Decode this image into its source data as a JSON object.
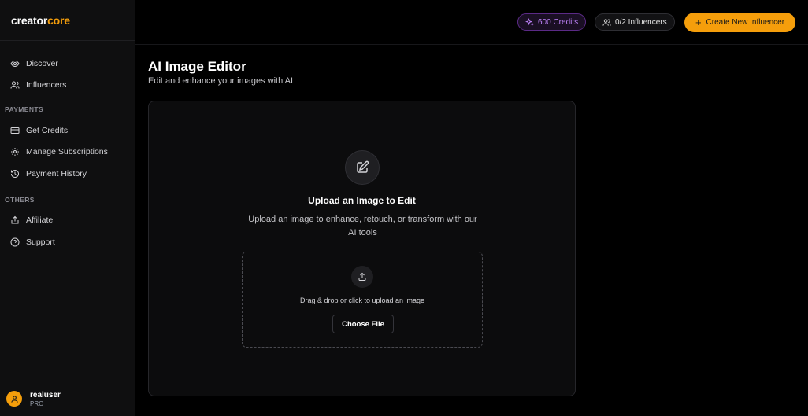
{
  "brand": {
    "part1": "creator",
    "part2": "core"
  },
  "sidebar": {
    "main_items": [
      {
        "label": "Discover",
        "icon": "eye-icon"
      },
      {
        "label": "Influencers",
        "icon": "users-icon"
      }
    ],
    "payments_label": "PAYMENTS",
    "payment_items": [
      {
        "label": "Get Credits",
        "icon": "card-icon"
      },
      {
        "label": "Manage Subscriptions",
        "icon": "gear-icon"
      },
      {
        "label": "Payment History",
        "icon": "history-icon"
      }
    ],
    "others_label": "OTHERS",
    "other_items": [
      {
        "label": "Affiliate",
        "icon": "share-icon"
      },
      {
        "label": "Support",
        "icon": "help-icon"
      }
    ]
  },
  "user": {
    "name": "realuser",
    "plan": "PRO"
  },
  "topbar": {
    "credits": "600 Credits",
    "influencers": "0/2 Influencers",
    "create_label": "Create New Influencer"
  },
  "main": {
    "title": "AI Image Editor",
    "subtitle": "Edit and enhance your images with AI",
    "card_title": "Upload an Image to Edit",
    "card_desc": "Upload an image to enhance, retouch, or transform with our AI tools",
    "dropzone_text": "Drag & drop or click to upload an image",
    "choose_label": "Choose File"
  },
  "colors": {
    "accent": "#f59e0b",
    "credits": "#c084fc",
    "background": "#000000"
  }
}
